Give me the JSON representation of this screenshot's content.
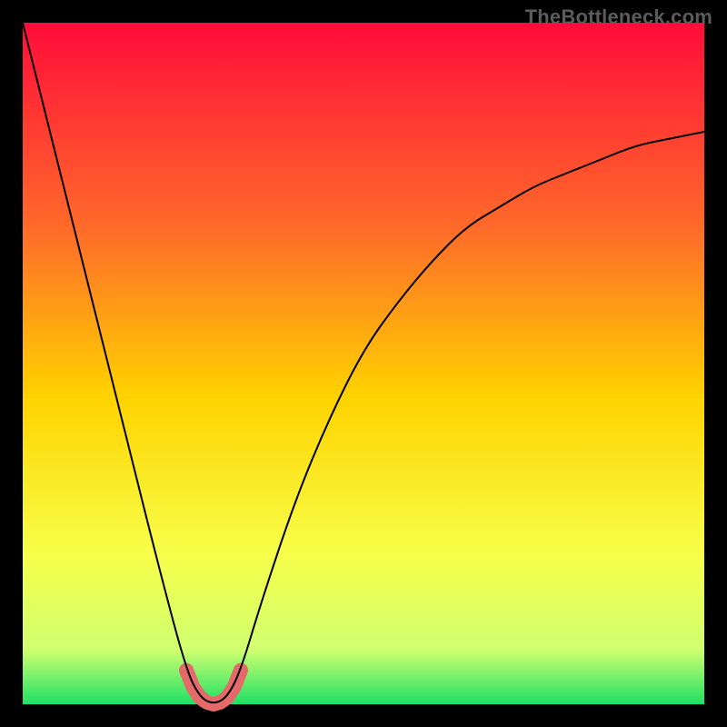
{
  "watermark": "TheBottleneck.com",
  "chart_data": {
    "type": "line",
    "title": "",
    "xlabel": "",
    "ylabel": "",
    "xlim": [
      0,
      100
    ],
    "ylim": [
      0,
      100
    ],
    "grid": false,
    "legend": false,
    "annotations": [],
    "series": [
      {
        "name": "bottleneck-curve",
        "x": [
          0,
          5,
          10,
          15,
          20,
          24,
          26,
          28,
          30,
          32,
          35,
          40,
          45,
          50,
          55,
          60,
          65,
          70,
          75,
          80,
          85,
          90,
          95,
          100
        ],
        "y": [
          100,
          80,
          60,
          40,
          20,
          5,
          1,
          0,
          1,
          5,
          15,
          30,
          42,
          52,
          59,
          65,
          70,
          73,
          76,
          78,
          80,
          82,
          83,
          84
        ]
      },
      {
        "name": "highlighted-minimum-segment",
        "x": [
          24,
          25,
          26,
          27,
          28,
          29,
          30,
          31,
          32
        ],
        "y": [
          5,
          2.5,
          1,
          0.3,
          0,
          0.3,
          1,
          2.5,
          5
        ]
      }
    ],
    "background_gradient": {
      "top_color": "#ff0c3a",
      "upper_mid_color": "#ff6a2a",
      "mid_color": "#ffd300",
      "lower_mid_color": "#f7ff4a",
      "near_bottom_color": "#d0ff70",
      "bottom_color": "#1fe065"
    },
    "plot_frame": {
      "x": 3.1,
      "y": 3.1,
      "width": 93.8,
      "height": 93.8,
      "stroke_width_percent": 3.1,
      "stroke_color": "#000000"
    },
    "highlight_style": {
      "stroke": "#e46a6a",
      "stroke_width_px": 16
    },
    "curve_style": {
      "stroke": "#000000",
      "stroke_width_px": 2
    }
  }
}
